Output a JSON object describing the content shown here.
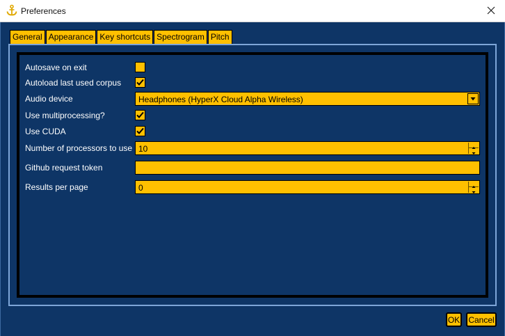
{
  "window": {
    "title": "Preferences",
    "app_icon": "anchor-icon",
    "close_icon": "close-icon"
  },
  "tabs": [
    {
      "label": "General",
      "active": true
    },
    {
      "label": "Appearance",
      "active": false
    },
    {
      "label": "Key shortcuts",
      "active": false
    },
    {
      "label": "Spectrogram",
      "active": false
    },
    {
      "label": "Pitch",
      "active": false
    }
  ],
  "settings": {
    "autosave": {
      "label": "Autosave on exit",
      "checked": false
    },
    "autoload": {
      "label": "Autoload last used corpus",
      "checked": true
    },
    "audio_device": {
      "label": "Audio device",
      "value": "Headphones (HyperX Cloud Alpha Wireless)"
    },
    "multiprocessing": {
      "label": "Use multiprocessing?",
      "checked": true
    },
    "cuda": {
      "label": "Use CUDA",
      "checked": true
    },
    "num_processors": {
      "label": "Number of processors to use",
      "value": "10"
    },
    "github_token": {
      "label": "Github request token",
      "value": ""
    },
    "results_per_page": {
      "label": "Results per page",
      "value": "0"
    }
  },
  "buttons": {
    "ok": "OK",
    "cancel": "Cancel"
  },
  "colors": {
    "background": "#0e3566",
    "accent": "#ffc000",
    "text": "#ffffff"
  }
}
